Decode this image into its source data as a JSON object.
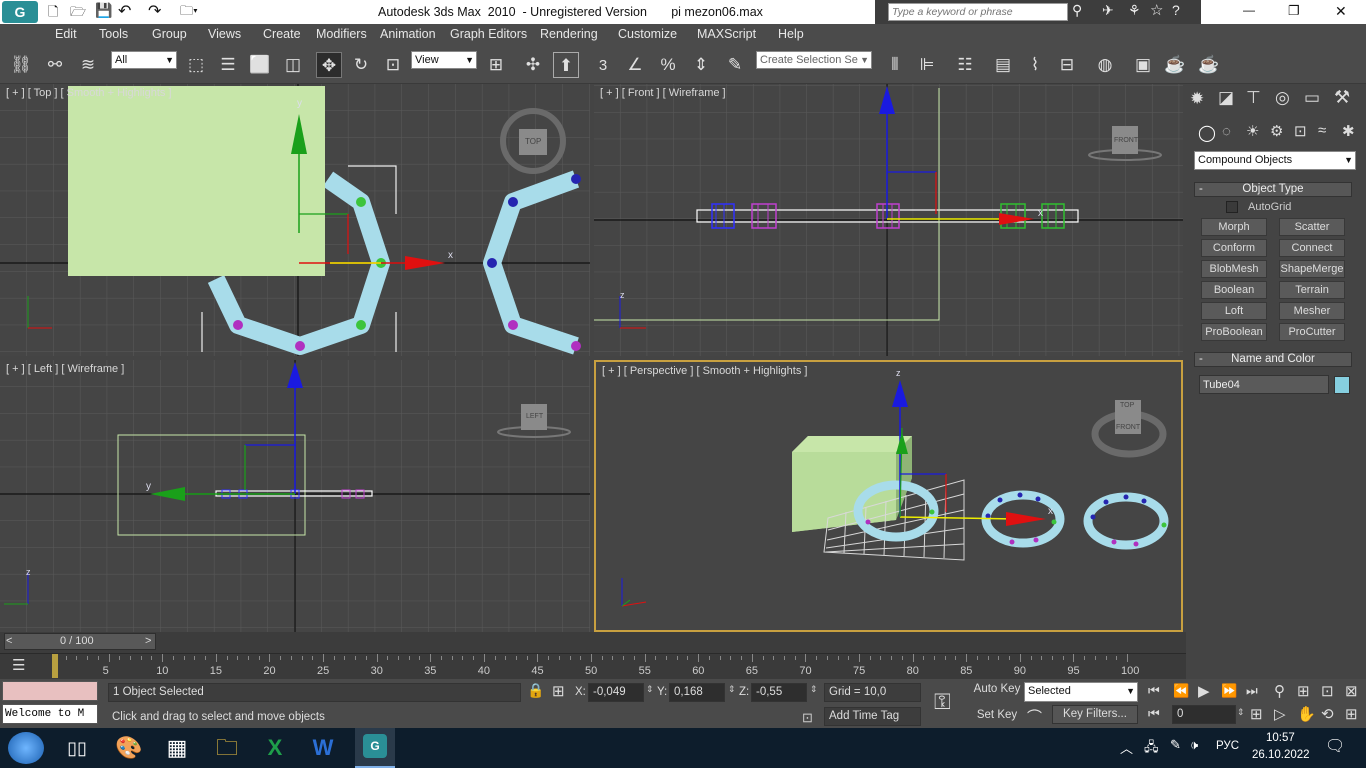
{
  "window": {
    "title": "Autodesk 3ds Max  2010  - Unregistered Version       pi mezon06.max",
    "search_placeholder": "Type a keyword or phrase",
    "minimize": "—",
    "maximize": "❐",
    "close": "✕"
  },
  "menu": [
    "Edit",
    "Tools",
    "Group",
    "Views",
    "Create",
    "Modifiers",
    "Animation",
    "Graph Editors",
    "Rendering",
    "Customize",
    "MAXScript",
    "Help"
  ],
  "toolbar": {
    "filter_value": "All",
    "refcoord_value": "View",
    "snap_label": "3",
    "selection_set_placeholder": "Create Selection Se"
  },
  "viewports": {
    "top": {
      "label": "[ + ] [ Top ] [ Smooth + Highlights ]",
      "cube_label": "TOP",
      "axis_y": "y",
      "axis_x": "x"
    },
    "front": {
      "label": "[ + ] [ Front ] [ Wireframe ]",
      "cube_label": "FRONT",
      "axis_z": "z",
      "axis_x": "x"
    },
    "left": {
      "label": "[ + ] [ Left ] [ Wireframe ]",
      "cube_label": "LEFT",
      "axis_y": "y",
      "axis_z": "z"
    },
    "perspective": {
      "label": "[ + ] [ Perspective ] [ Smooth + Highlights ]",
      "cube_top": "TOP",
      "cube_front": "FRONT",
      "axis_z": "z",
      "axis_x": "x"
    }
  },
  "command_panel": {
    "category_value": "Compound Objects",
    "object_type_title": "Object Type",
    "autogrid_label": "AutoGrid",
    "buttons": [
      "Morph",
      "Scatter",
      "Conform",
      "Connect",
      "BlobMesh",
      "ShapeMerge",
      "Boolean",
      "Terrain",
      "Loft",
      "Mesher",
      "ProBoolean",
      "ProCutter"
    ],
    "name_color_title": "Name and Color",
    "object_name": "Tube04",
    "object_color": "#86cfe0"
  },
  "timeline": {
    "slider_label": "0 / 100",
    "ticks": [
      "5",
      "10",
      "15",
      "20",
      "25",
      "30",
      "35",
      "40",
      "45",
      "50",
      "55",
      "60",
      "65",
      "70",
      "75",
      "80",
      "85",
      "90",
      "95",
      "100"
    ],
    "prev": "<",
    "next": ">"
  },
  "status": {
    "maxscript_text": "Welcome to M",
    "selection_text": "1 Object Selected",
    "prompt_text": "Click and drag to select and move objects",
    "x_label": "X:",
    "x_value": "-0,049",
    "y_label": "Y:",
    "y_value": "0,168",
    "z_label": "Z:",
    "z_value": "-0,55",
    "grid_text": "Grid = 10,0",
    "add_time_tag": "Add Time Tag",
    "auto_key": "Auto Key",
    "set_key": "Set Key",
    "key_mode_value": "Selected",
    "key_filters": "Key Filters...",
    "frame_value": "0"
  },
  "taskbar": {
    "language": "РУС",
    "time": "10:57",
    "date": "26.10.2022"
  },
  "colors": {
    "viewport_bg": "#454545",
    "box_green": "#c7e6a9",
    "tube_blue": "#a8dcea",
    "axis_red": "#e01010",
    "axis_green": "#1aa01a",
    "axis_blue": "#1a1ae0",
    "active_border": "#c8a040"
  }
}
